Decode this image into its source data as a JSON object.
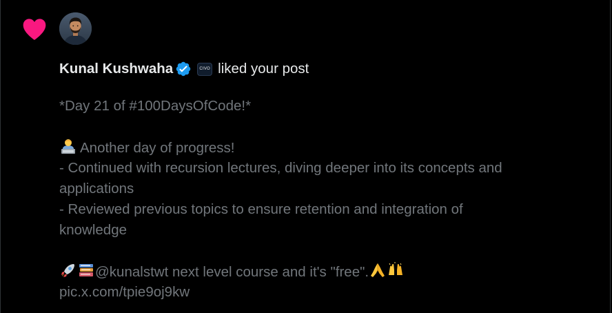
{
  "notification": {
    "type_icon": "heart-icon",
    "accent_color": "#f91880",
    "user": {
      "avatar_icon": "user-avatar",
      "name": "Kunal Kushwaha",
      "verified_icon": "verified-badge-icon",
      "verified_color": "#1d9bf0",
      "affiliate_badge": "CIVO"
    },
    "action": "liked your post"
  },
  "post": {
    "line1": "*Day 21 of #100DaysOfCode!*",
    "emoji1": "technologist-emoji",
    "line2": "Another day of progress!",
    "line3": "- Continued with recursion lectures, diving deeper into its concepts and",
    "line4": "applications",
    "line5": "- Reviewed previous topics to ensure retention and integration of",
    "line6": "knowledge",
    "emoji_rocket": "rocket-emoji",
    "emoji_books": "books-emoji",
    "line7_text": "@kunalstwt  next level course and it's \"free\".",
    "emoji_pray": "folded-hands-emoji",
    "emoji_raise": "raising-hands-emoji",
    "link": "pic.x.com/tpie9oj9kw"
  }
}
